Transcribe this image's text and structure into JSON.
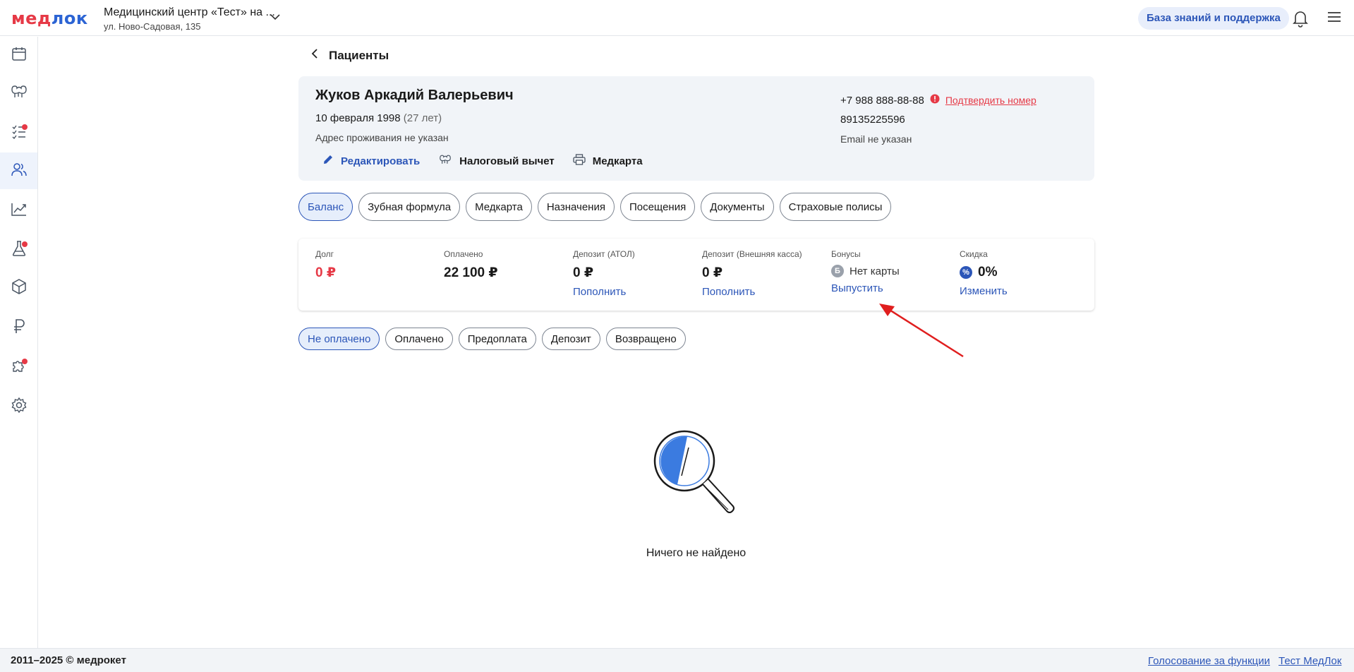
{
  "header": {
    "logo_part1": "мед",
    "logo_part2": "лок",
    "clinic_name": "Медицинский центр «Тест» на ...",
    "clinic_address": "ул. Ново-Садовая, 135",
    "kb_button": "База знаний и поддержка"
  },
  "sidebar": {
    "items": [
      {
        "icon": "calendar-icon"
      },
      {
        "icon": "tooth-icon"
      },
      {
        "icon": "tasks-icon",
        "badge": true
      },
      {
        "icon": "patients-icon",
        "active": true
      },
      {
        "icon": "analytics-icon"
      },
      {
        "icon": "lab-icon",
        "badge": true
      },
      {
        "icon": "warehouse-icon"
      },
      {
        "icon": "finance-icon"
      },
      {
        "icon": "integrations-icon",
        "badge": true
      },
      {
        "icon": "settings-icon"
      }
    ]
  },
  "page": {
    "back_label": "Пациенты"
  },
  "patient": {
    "name": "Жуков Аркадий Валерьевич",
    "dob": "10 февраля 1998",
    "age": "(27 лет)",
    "address": "Адрес проживания не указан",
    "phone": "+7 988 888-88-88",
    "confirm_label": "Подтвердить номер",
    "phone2": "89135225596",
    "email": "Email не указан",
    "actions": {
      "edit": "Редактировать",
      "tax": "Налоговый вычет",
      "medcard": "Медкарта"
    }
  },
  "tabs": [
    "Баланс",
    "Зубная формула",
    "Медкарта",
    "Назначения",
    "Посещения",
    "Документы",
    "Страховые полисы"
  ],
  "balance": {
    "debt": {
      "label": "Долг",
      "value": "0 ₽"
    },
    "paid": {
      "label": "Оплачено",
      "value": "22 100 ₽"
    },
    "deposit_atol": {
      "label": "Депозит (АТОЛ)",
      "value": "0 ₽",
      "link": "Пополнить"
    },
    "deposit_ext": {
      "label": "Депозит (Внешняя касса)",
      "value": "0 ₽",
      "link": "Пополнить"
    },
    "bonus": {
      "label": "Бонусы",
      "badge": "Б",
      "value": "Нет карты",
      "link": "Выпустить"
    },
    "discount": {
      "label": "Скидка",
      "badge": "%",
      "value": "0%",
      "link": "Изменить"
    }
  },
  "filters": [
    "Не оплачено",
    "Оплачено",
    "Предоплата",
    "Депозит",
    "Возвращено"
  ],
  "empty_text": "Ничего не найдено",
  "footer": {
    "copyright": "2011–2025 © медрокет",
    "link1": "Голосование за функции",
    "link2": "Тест МедЛок"
  },
  "colors": {
    "accent": "#2c56b8",
    "danger": "#e63946",
    "card_bg": "#f1f4f8"
  }
}
